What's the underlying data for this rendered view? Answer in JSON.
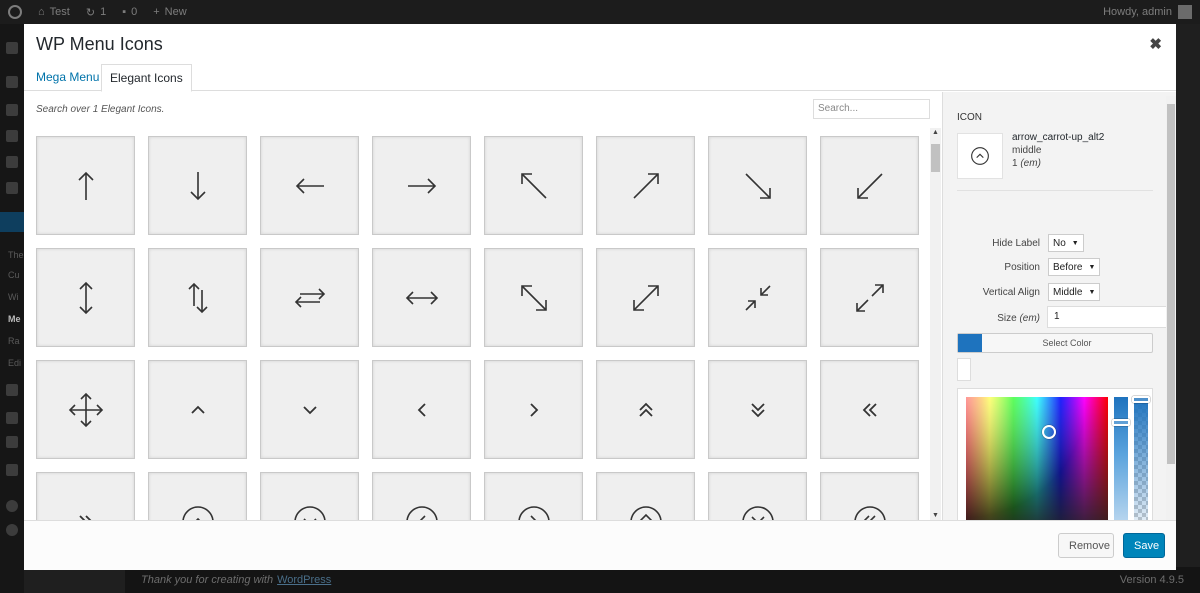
{
  "admin_bar": {
    "site_name": "Test",
    "updates_count": "1",
    "comments_count": "0",
    "new_label": "New",
    "greeting": "Howdy, admin"
  },
  "side_menu": {
    "items": [
      "The",
      "Cu",
      "Wi",
      "Me",
      "Ra",
      "Edi"
    ]
  },
  "footer_under": {
    "thanks_text": "Thank you for creating with",
    "thanks_link": "WordPress",
    "version": "Version 4.9.5"
  },
  "modal": {
    "title": "WP Menu Icons",
    "close_glyph": "✖",
    "tabs": [
      {
        "label": "Mega Menu"
      },
      {
        "label": "Elegant Icons"
      }
    ],
    "search": {
      "caption": "Search over 1 Elegant Icons.",
      "placeholder": "Search..."
    },
    "icon_grid": [
      {
        "name": "arrow-up-icon"
      },
      {
        "name": "arrow-down-icon"
      },
      {
        "name": "arrow-left-icon"
      },
      {
        "name": "arrow-right-icon"
      },
      {
        "name": "arrow-up-left-icon"
      },
      {
        "name": "arrow-up-right-icon"
      },
      {
        "name": "arrow-down-right-icon"
      },
      {
        "name": "arrow-down-left-icon"
      },
      {
        "name": "arrow-up-down-icon"
      },
      {
        "name": "arrows-up-down-split-icon"
      },
      {
        "name": "arrows-left-right-split-icon"
      },
      {
        "name": "arrow-left-right-icon"
      },
      {
        "name": "expand-diagonal-icon"
      },
      {
        "name": "expand-diagonal-alt-icon"
      },
      {
        "name": "collapse-icon"
      },
      {
        "name": "expand-icon"
      },
      {
        "name": "move-icon"
      },
      {
        "name": "carrot-up-icon"
      },
      {
        "name": "carrot-down-icon"
      },
      {
        "name": "carrot-left-icon"
      },
      {
        "name": "carrot-right-icon"
      },
      {
        "name": "carrot-2up-icon"
      },
      {
        "name": "carrot-2down-icon"
      },
      {
        "name": "carrot-2left-icon"
      },
      {
        "name": "carrot-2right-icon"
      },
      {
        "name": "carrot-up-circle-icon"
      },
      {
        "name": "carrot-down-circle-icon"
      },
      {
        "name": "carrot-left-circle-icon"
      },
      {
        "name": "carrot-right-circle-icon"
      },
      {
        "name": "carrot-2up-circle-icon"
      },
      {
        "name": "carrot-2down-circle-icon"
      },
      {
        "name": "carrot-2left-circle-icon"
      }
    ],
    "sidebar": {
      "icon_label": "ICON",
      "selected": {
        "name": "arrow_carrot-up_alt2",
        "align": "middle",
        "size_value": "1",
        "size_unit": "(em)",
        "icon": "carrot-up-circle-icon"
      },
      "fields": {
        "hide_label": {
          "label": "Hide Label",
          "value": "No"
        },
        "position": {
          "label": "Position",
          "value": "Before"
        },
        "vertical_align": {
          "label": "Vertical Align",
          "value": "Middle"
        },
        "size": {
          "label": "Size",
          "unit": "(em)",
          "value": "1"
        }
      },
      "color": {
        "button_label": "Select Color",
        "value": "#1e73be"
      },
      "palette": [
        "#000000",
        "#ffffff",
        "#dd3333",
        "#dd9933",
        "#eeee22",
        "#81d742",
        "#1e73be",
        "#8224e3"
      ]
    },
    "footer": {
      "remove_label": "Remove",
      "save_label": "Save"
    }
  }
}
